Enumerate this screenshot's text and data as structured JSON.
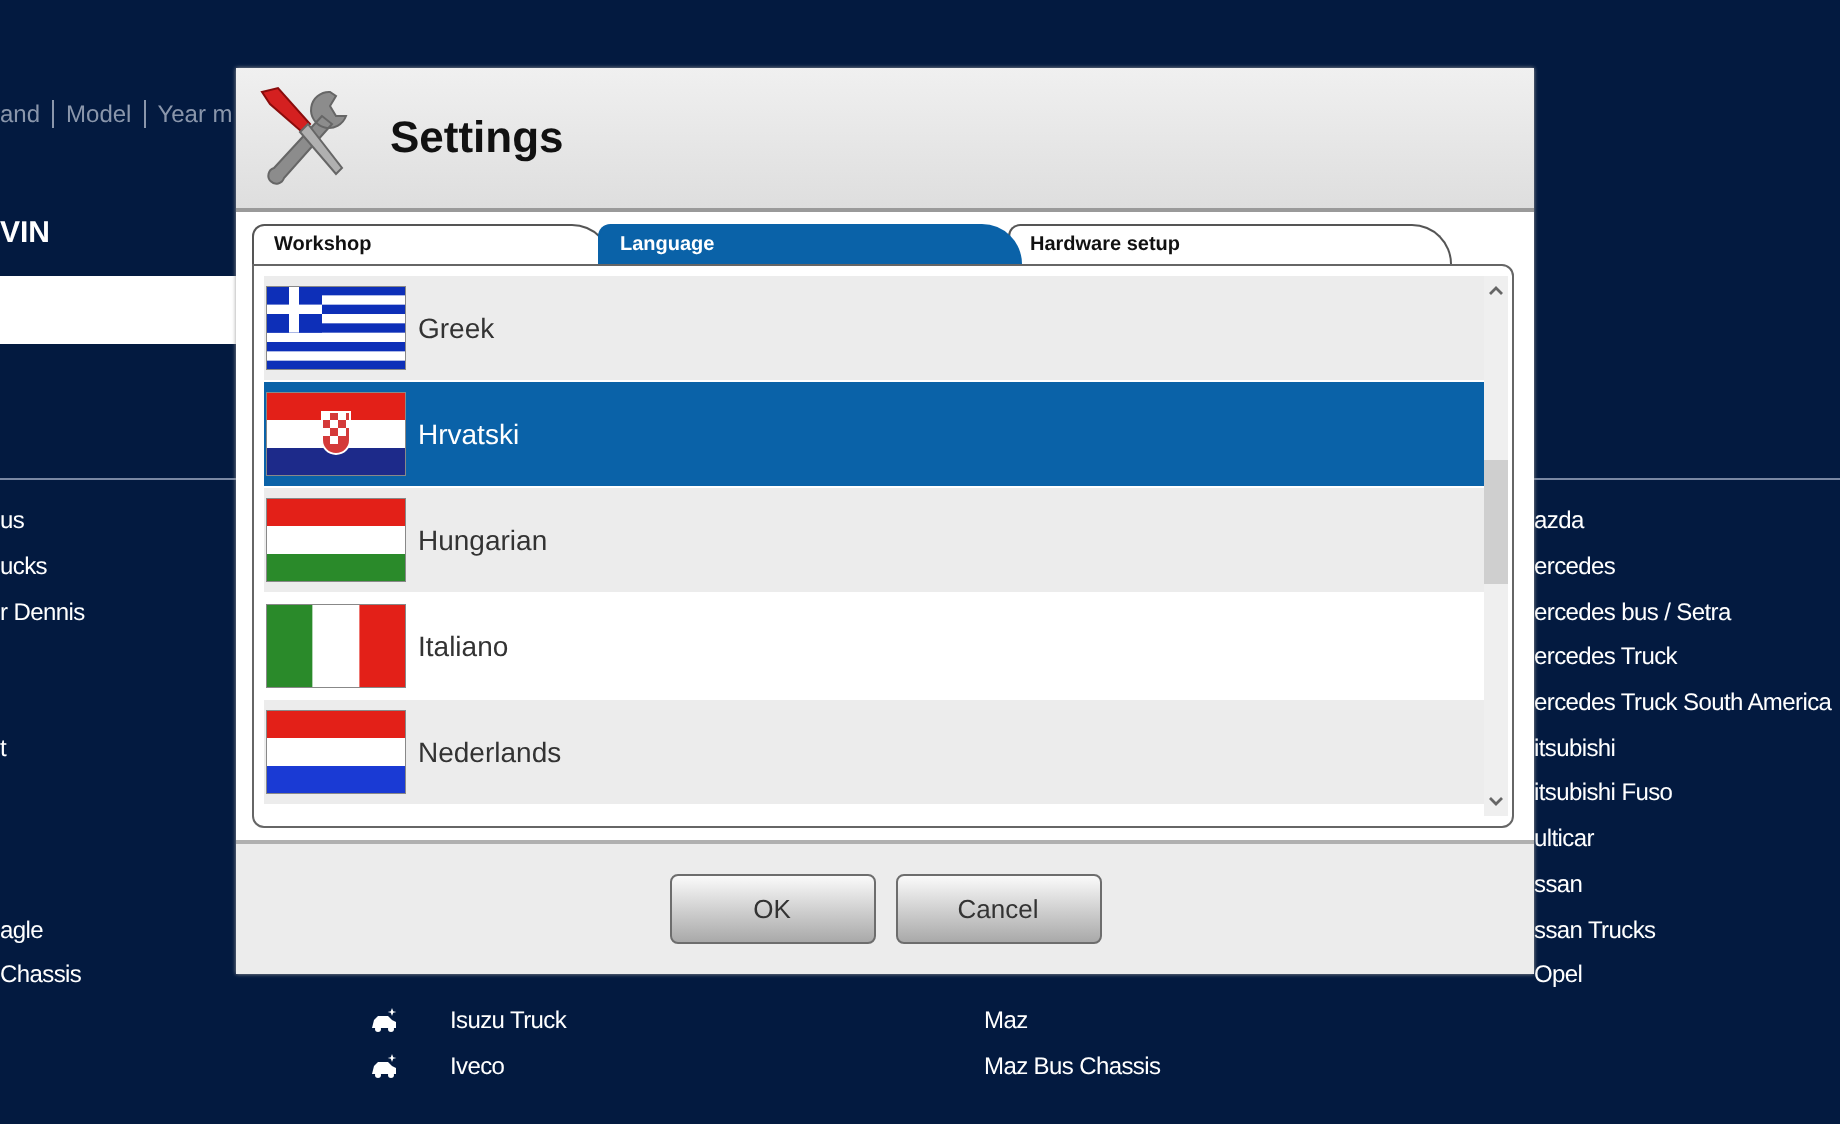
{
  "background": {
    "breadcrumb": [
      "and",
      "Model",
      "Year m"
    ],
    "vin_label": "VIN",
    "brand_columns": [
      {
        "groups": [
          [
            {
              "label": "us"
            },
            {
              "label": "ucks"
            },
            {
              "label": "r Dennis"
            }
          ],
          [
            {
              "label": "t"
            }
          ],
          [
            {
              "label": "agle"
            },
            {
              "label": "Chassis"
            }
          ]
        ]
      },
      {
        "groups": [
          [
            {
              "label": "Isuzu Truck",
              "icon": true
            },
            {
              "label": "Iveco",
              "icon": true
            }
          ]
        ]
      },
      {
        "groups": [
          [
            {
              "label": "Maz",
              "icon": false
            },
            {
              "label": "Maz Bus Chassis",
              "icon": false
            }
          ]
        ]
      },
      {
        "groups": [
          [
            {
              "label": "azda"
            },
            {
              "label": "ercedes"
            },
            {
              "label": "ercedes bus / Setra"
            },
            {
              "label": "ercedes Truck"
            },
            {
              "label": "ercedes Truck South America"
            },
            {
              "label": "itsubishi"
            },
            {
              "label": "itsubishi Fuso"
            },
            {
              "label": "ulticar"
            },
            {
              "label": "ssan"
            },
            {
              "label": "ssan Trucks"
            },
            {
              "label": "Opel"
            }
          ]
        ]
      }
    ]
  },
  "dialog": {
    "title": "Settings",
    "tabs": [
      {
        "label": "Workshop",
        "selected": false
      },
      {
        "label": "Language",
        "selected": true
      },
      {
        "label": "Hardware setup",
        "selected": false
      }
    ],
    "languages": [
      {
        "label": "Greek",
        "selected": false
      },
      {
        "label": "Hrvatski",
        "selected": true
      },
      {
        "label": "Hungarian",
        "selected": false
      },
      {
        "label": "Italiano",
        "selected": false
      },
      {
        "label": "Nederlands",
        "selected": false
      }
    ],
    "buttons": [
      "OK",
      "Cancel"
    ]
  }
}
